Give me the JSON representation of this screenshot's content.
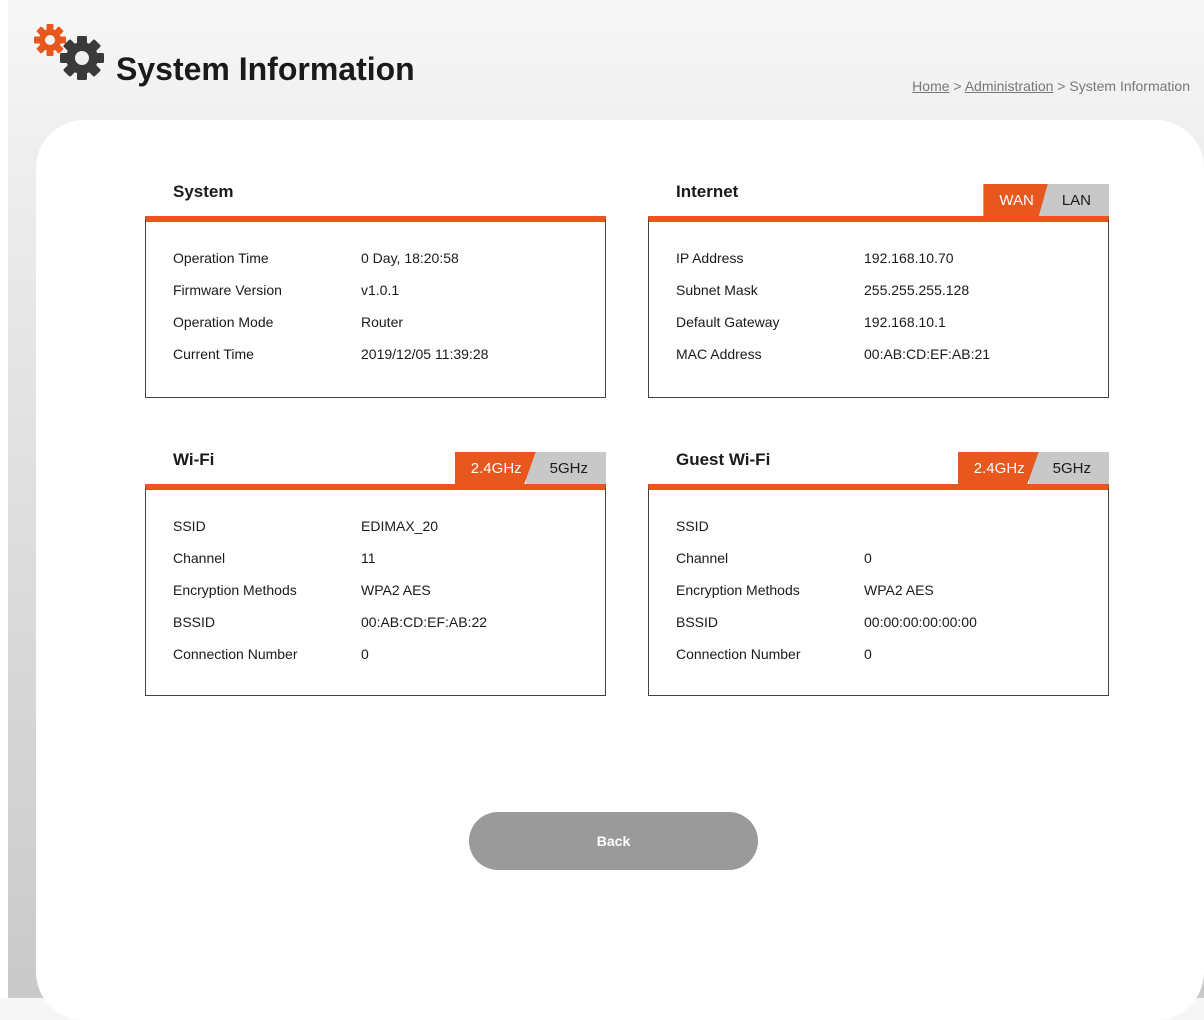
{
  "header": {
    "title": "System Information",
    "logo_icon": "gears-icon",
    "breadcrumb": {
      "home": "Home",
      "sep1": " > ",
      "administration": "Administration",
      "sep2": " > ",
      "current": "System Information"
    }
  },
  "colors": {
    "accent": "#e8571e",
    "tab_inactive": "#c8c8c8",
    "button": "#9a9a9a"
  },
  "system": {
    "title": "System",
    "rows": [
      {
        "label": "Operation Time",
        "value": "0 Day, 18:20:58"
      },
      {
        "label": "Firmware Version",
        "value": "v1.0.1"
      },
      {
        "label": "Operation Mode",
        "value": "Router"
      },
      {
        "label": "Current Time",
        "value": "2019/12/05 11:39:28"
      }
    ]
  },
  "internet": {
    "title": "Internet",
    "tabs": [
      "WAN",
      "LAN"
    ],
    "active_tab": "WAN",
    "rows": [
      {
        "label": "IP Address",
        "value": "192.168.10.70"
      },
      {
        "label": "Subnet Mask",
        "value": "255.255.255.128"
      },
      {
        "label": "Default Gateway",
        "value": "192.168.10.1"
      },
      {
        "label": "MAC Address",
        "value": "00:AB:CD:EF:AB:21"
      }
    ]
  },
  "wifi": {
    "title": "Wi-Fi",
    "tabs": [
      "2.4GHz",
      "5GHz"
    ],
    "active_tab": "2.4GHz",
    "rows": [
      {
        "label": "SSID",
        "value": "EDIMAX_20"
      },
      {
        "label": "Channel",
        "value": "11"
      },
      {
        "label": "Encryption Methods",
        "value": "WPA2 AES"
      },
      {
        "label": "BSSID",
        "value": "00:AB:CD:EF:AB:22"
      },
      {
        "label": "Connection Number",
        "value": "0"
      }
    ]
  },
  "guest_wifi": {
    "title": "Guest Wi-Fi",
    "tabs": [
      "2.4GHz",
      "5GHz"
    ],
    "active_tab": "2.4GHz",
    "rows": [
      {
        "label": "SSID",
        "value": ""
      },
      {
        "label": "Channel",
        "value": "0"
      },
      {
        "label": "Encryption Methods",
        "value": "WPA2 AES"
      },
      {
        "label": "BSSID",
        "value": "00:00:00:00:00:00"
      },
      {
        "label": "Connection Number",
        "value": "0"
      }
    ]
  },
  "actions": {
    "back_label": "Back"
  }
}
